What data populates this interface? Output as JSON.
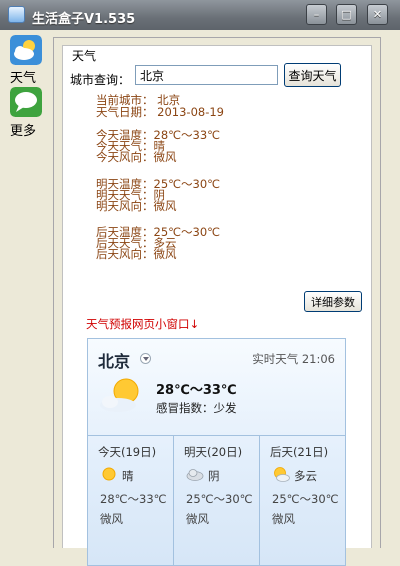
{
  "window": {
    "title": "生活盒子V1.535"
  },
  "sidebar": {
    "items": [
      {
        "label": "天气",
        "icon": "cloud-sun-icon"
      },
      {
        "label": "更多",
        "icon": "speech-bubble-icon"
      }
    ]
  },
  "panel": {
    "title": "天气",
    "query_label": "城市查询：",
    "query_value": "北京",
    "query_button": "查询天气",
    "info": [
      [
        "当前城市：  北京",
        "天气日期：  2013-08-19"
      ],
      [
        "今天温度：28℃～33℃",
        "今天天气：晴",
        "今天风向：微风"
      ],
      [
        "明天温度：25℃～30℃",
        "明天天气：阴",
        "明天风向：微风"
      ],
      [
        "后天温度：25℃～30℃",
        "后天天气：多云",
        "后天风向：微风"
      ]
    ],
    "detail_button": "详细参数",
    "widget_caption": "天气预报网页小窗口↓"
  },
  "widget": {
    "city": "北京",
    "realtime": "实时天气 21:06",
    "temp_range": "28℃～33℃",
    "cold_index": "感冒指数：少发",
    "forecast": [
      {
        "day": "今天(19日)",
        "desc": "晴",
        "temp": "28℃～33℃",
        "wind": "微风",
        "icon": "sun-icon"
      },
      {
        "day": "明天(20日)",
        "desc": "阴",
        "temp": "25℃～30℃",
        "wind": "微风",
        "icon": "cloud-icon"
      },
      {
        "day": "后天(21日)",
        "desc": "多云",
        "temp": "25℃～30℃",
        "wind": "微风",
        "icon": "partly-cloudy-icon"
      }
    ]
  },
  "colors": {
    "info_text": "#8b4513",
    "caption_red": "#d00000",
    "titlebar": "#6a7077"
  }
}
